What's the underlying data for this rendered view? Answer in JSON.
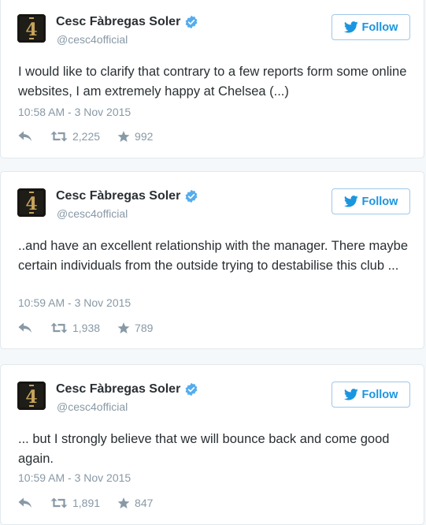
{
  "colors": {
    "link_blue": "#1b95e0",
    "verified_blue": "#55acee",
    "text": "#292f33",
    "muted": "#8899a6",
    "avatar_gold": "#c6a35a"
  },
  "tweets": [
    {
      "author": "Cesc Fàbregas Soler",
      "handle": "@cesc4official",
      "follow_label": "Follow",
      "text": "I would like to clarify that contrary to a few reports form some online websites, I am extremely happy at Chelsea (...)",
      "timestamp": "10:58 AM - 3 Nov 2015",
      "retweets": "2,225",
      "likes": "992",
      "avatar_glyph": "4"
    },
    {
      "author": "Cesc Fàbregas Soler",
      "handle": "@cesc4official",
      "follow_label": "Follow",
      "text": "..and have an excellent relationship with the manager. There maybe certain individuals from the outside trying to destabilise this club ...",
      "timestamp": "10:59 AM - 3 Nov 2015",
      "retweets": "1,938",
      "likes": "789",
      "avatar_glyph": "4"
    },
    {
      "author": "Cesc Fàbregas Soler",
      "handle": "@cesc4official",
      "follow_label": "Follow",
      "text": "... but I strongly believe that we will bounce back and come good again.",
      "timestamp": "10:59 AM - 3 Nov 2015",
      "retweets": "1,891",
      "likes": "847",
      "avatar_glyph": "4"
    }
  ]
}
